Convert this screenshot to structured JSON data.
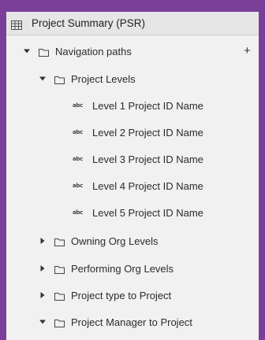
{
  "panel": {
    "title": "Project Summary (PSR)",
    "title_icon": "data-module-icon"
  },
  "tree": {
    "navigation_paths": {
      "label": "Navigation paths",
      "expanded": true,
      "add_label": "+"
    },
    "project_levels": {
      "label": "Project Levels",
      "expanded": true,
      "items": [
        "Level 1 Project ID Name",
        "Level 2 Project ID Name",
        "Level 3 Project ID Name",
        "Level 4 Project ID Name",
        "Level 5 Project ID Name"
      ],
      "item_badge": "abc"
    },
    "folders": [
      {
        "label": "Owning Org Levels",
        "expanded": false
      },
      {
        "label": "Performing Org Levels",
        "expanded": false
      },
      {
        "label": "Project type to Project",
        "expanded": false
      },
      {
        "label": "Project Manager to Project",
        "expanded": true
      }
    ]
  },
  "colors": {
    "background": "#7b3f9a",
    "panel": "#f1f1f1",
    "header": "#e6e6e6",
    "text": "#2b2b2b"
  }
}
